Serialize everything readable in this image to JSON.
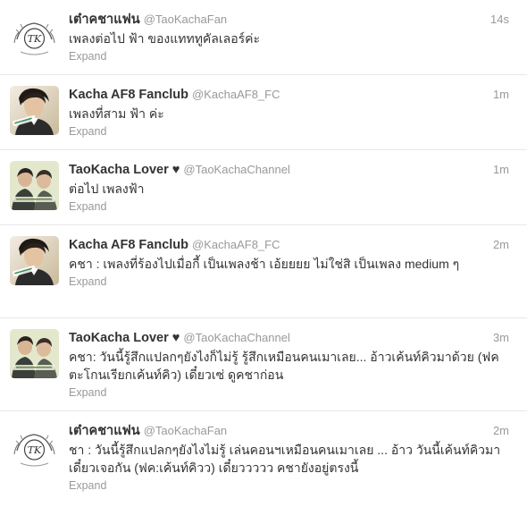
{
  "tweets": [
    {
      "fullname": "เต๋าคชาแฟน",
      "username": "@TaoKachaFan",
      "time": "14s",
      "text": "เพลงต่อไป ฟ้า ของแทททูคัลเลอร์ค่ะ",
      "expand": "Expand",
      "avatar": "logo",
      "avatar_monogram": "TK"
    },
    {
      "fullname": "Kacha AF8 Fanclub",
      "username": "@KachaAF8_FC",
      "time": "1m",
      "text": "เพลงที่สาม ฟ้า ค่ะ",
      "expand": "Expand",
      "avatar": "photo-person"
    },
    {
      "fullname": "TaoKacha Lover ♥",
      "username": "@TaoKachaChannel",
      "time": "1m",
      "text": "ต่อไป เพลงฟ้า",
      "expand": "Expand",
      "avatar": "photo-duo"
    },
    {
      "fullname": "Kacha AF8 Fanclub",
      "username": "@KachaAF8_FC",
      "time": "2m",
      "text": "คชา : เพลงที่ร้องไปเมื่อกี้ เป็นเพลงช้า เอ้ยยยย ไม่ใช่สิ เป็นเพลง medium ๆ",
      "expand": "Expand",
      "avatar": "photo-person"
    },
    {
      "fullname": "TaoKacha Lover ♥",
      "username": "@TaoKachaChannel",
      "time": "3m",
      "text": "คชา: วันนี้รู้สึกแปลกๆยังไงก็ไม่รู้ รู้สึกเหมือนคนเมาเลย... อ้าวเค้นท์คิวมาด้วย (ฟคตะโกนเรียกเค้นท์คิว) เดี๋ยวเซ่ ดูคชาก่อน",
      "expand": "Expand",
      "avatar": "photo-duo"
    },
    {
      "fullname": "เต๋าคชาแฟน",
      "username": "@TaoKachaFan",
      "time": "2m",
      "text": "ชา : วันนี้รู้สึกแปลกๆยังไงไม่รู้ เล่นคอนฯเหมือนคนเมาเลย ... อ้าว วันนี้เค้นท์คิวมา เดี๋ยวเจอกัน (ฟค:เค้นท์คิวว) เดี๋ยววววว คชายังอยู่ตรงนี้",
      "expand": "Expand",
      "avatar": "logo",
      "avatar_monogram": "TK"
    }
  ]
}
